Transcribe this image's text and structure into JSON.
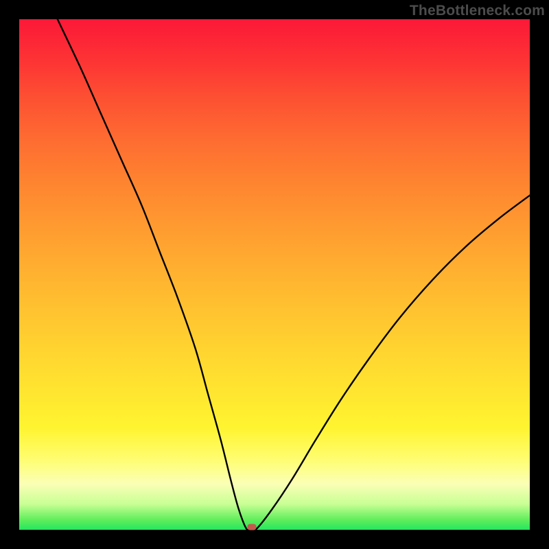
{
  "watermark": "TheBottleneck.com",
  "marker": {
    "x_frac": 0.455,
    "y_frac": 0.994,
    "color": "#c5584d"
  },
  "chart_data": {
    "type": "line",
    "title": "",
    "xlabel": "",
    "ylabel": "",
    "xlim": [
      0,
      1
    ],
    "ylim": [
      0,
      1
    ],
    "grid": false,
    "series": [
      {
        "name": "left-branch",
        "x": [
          0.075,
          0.12,
          0.16,
          0.2,
          0.24,
          0.275,
          0.31,
          0.345,
          0.37,
          0.395,
          0.415,
          0.43,
          0.445
        ],
        "y": [
          1.0,
          0.905,
          0.815,
          0.725,
          0.635,
          0.545,
          0.455,
          0.355,
          0.265,
          0.175,
          0.095,
          0.04,
          0.002
        ]
      },
      {
        "name": "trough",
        "x": [
          0.445,
          0.455,
          0.465
        ],
        "y": [
          0.002,
          0.001,
          0.002
        ]
      },
      {
        "name": "right-branch",
        "x": [
          0.465,
          0.495,
          0.535,
          0.58,
          0.63,
          0.685,
          0.745,
          0.81,
          0.875,
          0.94,
          1.0
        ],
        "y": [
          0.002,
          0.04,
          0.1,
          0.175,
          0.255,
          0.335,
          0.415,
          0.49,
          0.555,
          0.61,
          0.655
        ]
      }
    ],
    "annotations": [
      {
        "name": "dip-marker",
        "x": 0.455,
        "y": 0.001
      }
    ],
    "background_gradient": {
      "direction": "vertical",
      "stops": [
        {
          "pos": 0.0,
          "color": "#fc1838"
        },
        {
          "pos": 0.5,
          "color": "#ffb030"
        },
        {
          "pos": 0.8,
          "color": "#fff430"
        },
        {
          "pos": 1.0,
          "color": "#24e75e"
        }
      ]
    }
  }
}
